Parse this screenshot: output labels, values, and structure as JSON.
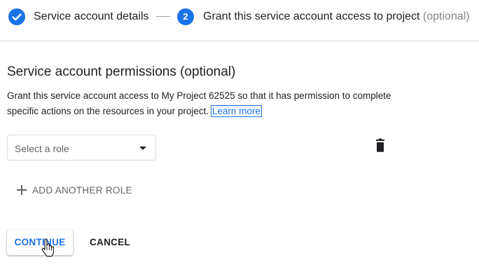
{
  "stepper": {
    "step1": {
      "label": "Service account details",
      "icon": "check-circle-icon",
      "status": "completed"
    },
    "step2": {
      "number": "2",
      "label": "Grant this service account access to project",
      "optional": "(optional)",
      "status": "active"
    }
  },
  "permissions": {
    "title": "Service account permissions (optional)",
    "description": "Grant this service account access to My Project 62525 so that it has permission to complete specific actions on the resources in your project.",
    "learn_more": "Learn more",
    "role_select": {
      "placeholder": "Select a role",
      "icon": "arrow-drop-down-icon"
    },
    "delete_icon": "trash-icon",
    "add_role_label": "ADD ANOTHER ROLE",
    "add_role_icon": "plus-icon"
  },
  "actions": {
    "continue_label": "CONTINUE",
    "cancel_label": "CANCEL"
  },
  "colors": {
    "primary": "#1a73e8",
    "text": "#202124",
    "muted": "#5f6368",
    "optional_text": "#80868b",
    "border": "#dadce0"
  }
}
